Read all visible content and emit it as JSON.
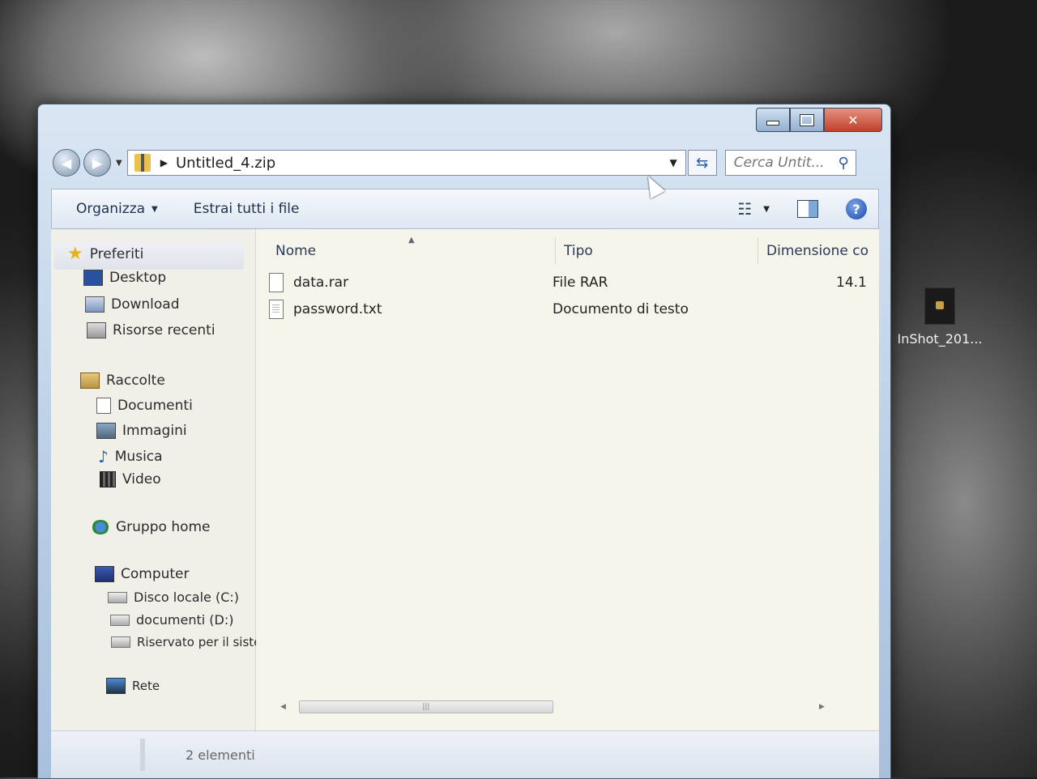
{
  "desktop": {
    "icon_label": "InShot_201..."
  },
  "window": {
    "address": {
      "crumb": "Untitled_4.zip"
    },
    "search": {
      "placeholder": "Cerca Untit..."
    },
    "toolbar": {
      "organize_label": "Organizza",
      "extract_label": "Estrai tutti i file"
    },
    "navpane": {
      "favorites": {
        "label": "Preferiti",
        "items": [
          "Desktop",
          "Download",
          "Risorse recenti"
        ]
      },
      "libraries": {
        "label": "Raccolte",
        "items": [
          "Documenti",
          "Immagini",
          "Musica",
          "Video"
        ]
      },
      "homegroup": "Gruppo home",
      "computer": {
        "label": "Computer",
        "items": [
          "Disco locale (C:)",
          "documenti (D:)",
          "Riservato per il sister"
        ]
      },
      "network": "Rete"
    },
    "columns": {
      "name": "Nome",
      "type": "Tipo",
      "size": "Dimensione co"
    },
    "files": [
      {
        "name": "data.rar",
        "type": "File RAR",
        "size": "14.1"
      },
      {
        "name": "password.txt",
        "type": "Documento di testo",
        "size": ""
      }
    ],
    "status": {
      "count_text": "2 elementi"
    }
  }
}
